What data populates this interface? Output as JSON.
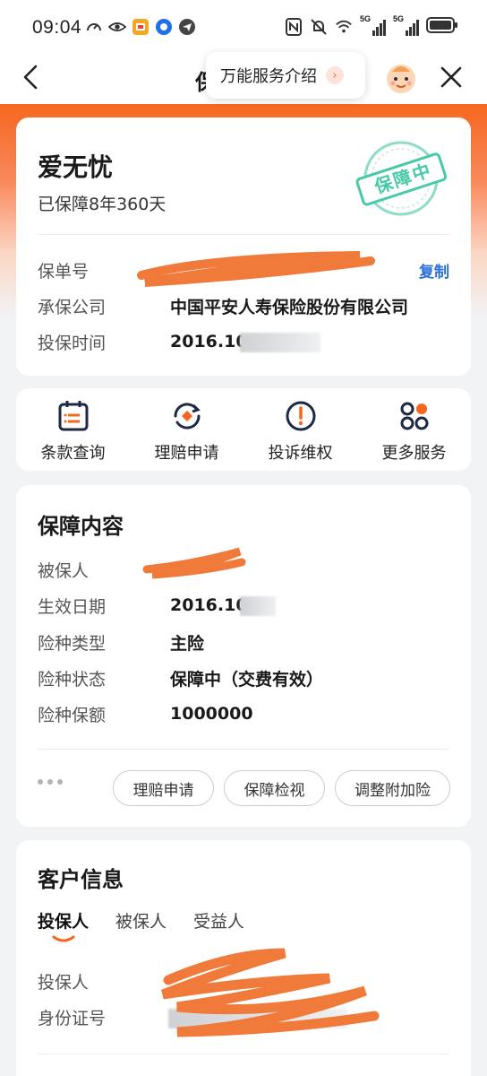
{
  "status": {
    "time": "09:04",
    "net1": "5G",
    "net2": "5G",
    "icons_left": [
      "gauge-icon",
      "eye-icon",
      "app-badge-icon",
      "browser-icon",
      "telegram-icon"
    ],
    "icons_right": [
      "nfc-icon",
      "mute-icon",
      "wifi-icon",
      "signal-icon",
      "signal-icon",
      "battery-icon"
    ]
  },
  "nav": {
    "title_partial": "保",
    "service_pill": "万能服务介绍",
    "service_arrow": "›"
  },
  "policy": {
    "name": "爱无忧",
    "days": "已保障8年360天",
    "stamp_text": "保障中",
    "rows": [
      {
        "label": "保单号",
        "value": ""
      },
      {
        "label": "承保公司",
        "value": "中国平安人寿保险股份有限公司"
      },
      {
        "label": "投保时间",
        "value": "2016.10"
      }
    ],
    "copy_label": "复制"
  },
  "actions": [
    {
      "label": "条款查询",
      "icon": "calendar-list-icon"
    },
    {
      "label": "理赔申请",
      "icon": "claim-refresh-icon"
    },
    {
      "label": "投诉维权",
      "icon": "alert-circle-icon"
    },
    {
      "label": "更多服务",
      "icon": "grid-apps-icon"
    }
  ],
  "coverage": {
    "title": "保障内容",
    "rows": [
      {
        "label": "被保人",
        "value": ""
      },
      {
        "label": "生效日期",
        "value": "2016.10"
      },
      {
        "label": "险种类型",
        "value": "主险"
      },
      {
        "label": "险种状态",
        "value": "保障中（交费有效）"
      },
      {
        "label": "险种保额",
        "value": "1000000"
      }
    ],
    "buttons": [
      "理赔申请",
      "保障检视",
      "调整附加险"
    ]
  },
  "customer": {
    "title": "客户信息",
    "tabs": [
      "投保人",
      "被保人",
      "受益人"
    ],
    "active_tab": 0,
    "rows": [
      {
        "label": "投保人",
        "value": ""
      },
      {
        "label": "身份证号",
        "value": ""
      }
    ]
  },
  "colors": {
    "brand_orange": "#f5671f",
    "link_blue": "#2a6fdb",
    "stamp_green": "#48c9a9"
  }
}
